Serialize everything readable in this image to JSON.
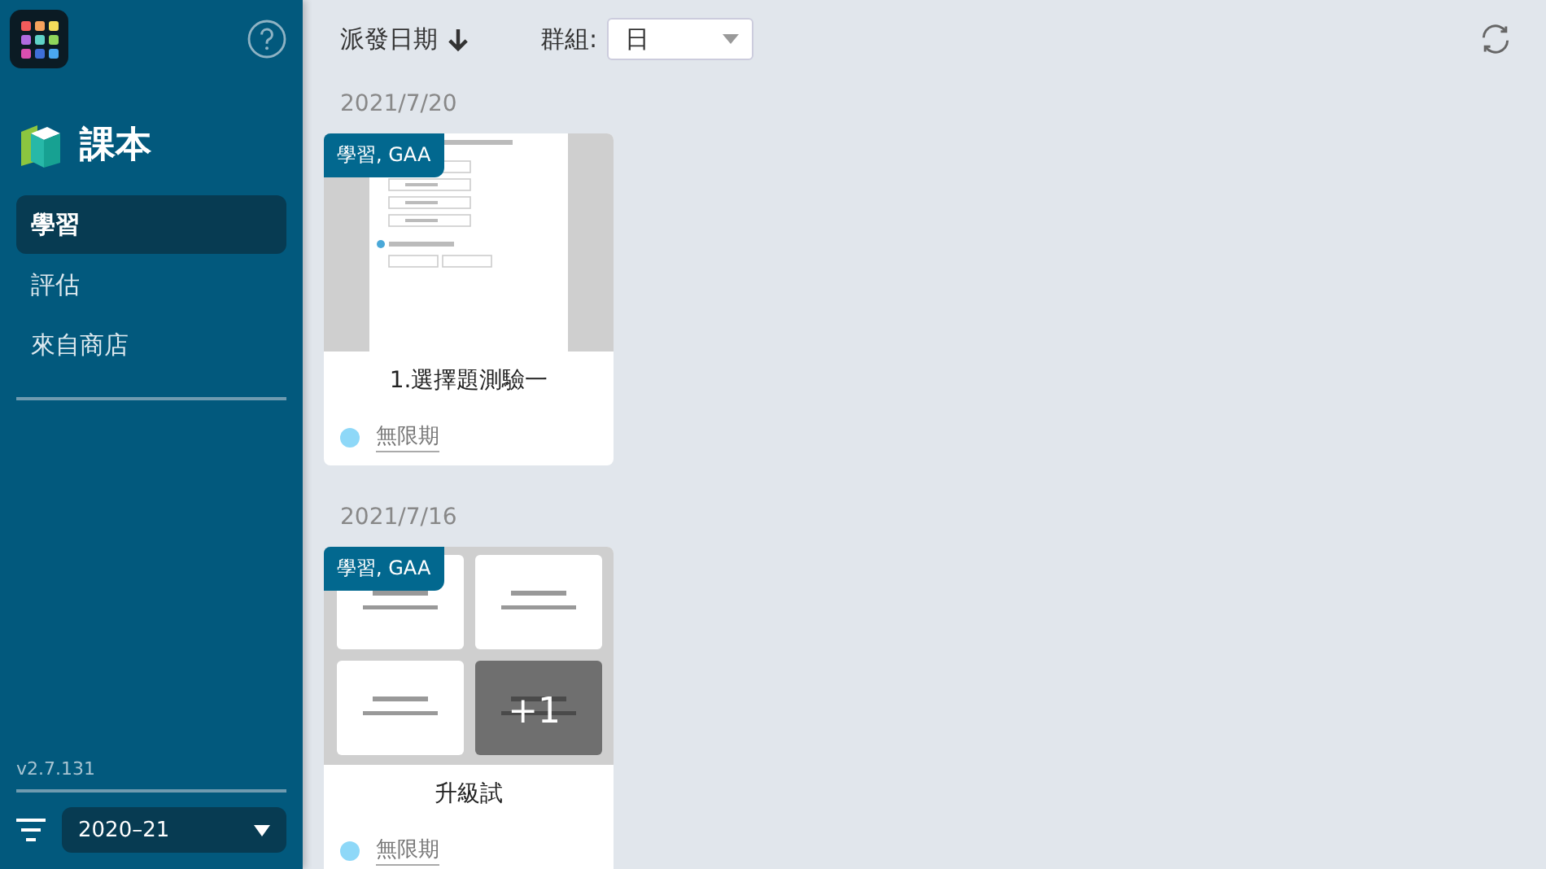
{
  "app_title": "課本",
  "nav": [
    {
      "label": "學習",
      "selected": true
    },
    {
      "label": "評估",
      "selected": false
    },
    {
      "label": "來自商店",
      "selected": false
    }
  ],
  "version": "v2.7.131",
  "year_select": {
    "value": "2020–21"
  },
  "toolbar": {
    "sort_label": "派發日期",
    "group_label": "群組:",
    "group_select": {
      "value": "日"
    }
  },
  "groups": [
    {
      "date": "2021/7/20",
      "cards": [
        {
          "tag": "學習, GAA",
          "title": "1.選擇題測驗一",
          "status": "無限期",
          "preview": {
            "kind": "single"
          }
        }
      ]
    },
    {
      "date": "2021/7/16",
      "cards": [
        {
          "tag": "學習, GAA",
          "title": "升級試",
          "status": "無限期",
          "preview": {
            "kind": "grid",
            "more": "+1"
          }
        }
      ]
    }
  ]
}
